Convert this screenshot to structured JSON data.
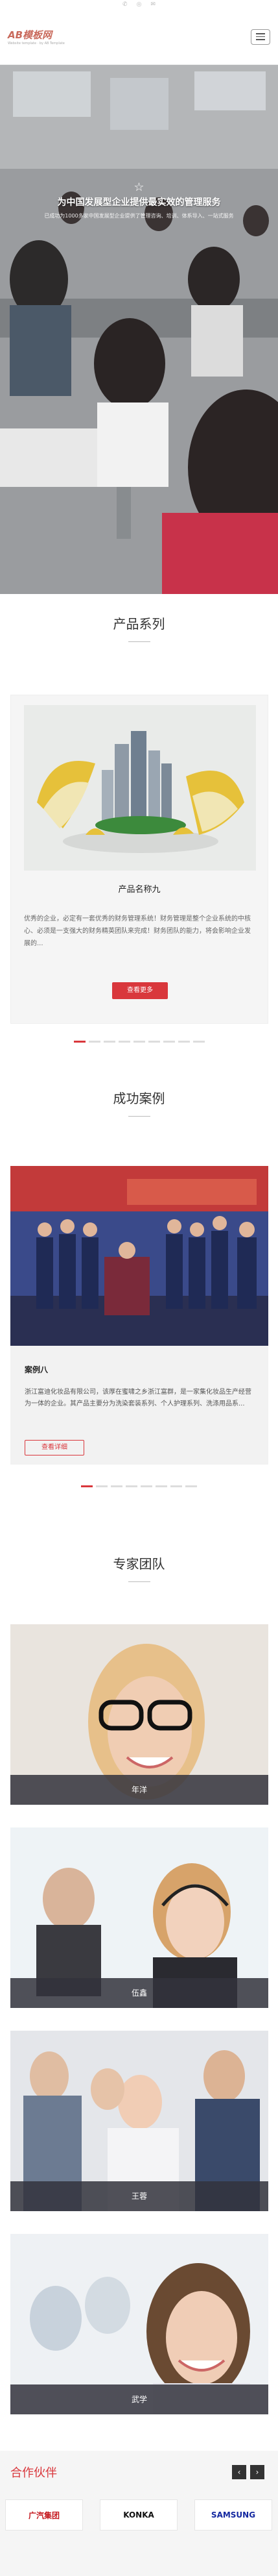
{
  "topbar": {
    "icons": [
      "phone-icon",
      "weibo-icon",
      "wechat-icon"
    ]
  },
  "header": {
    "logo_text": "AB模板网",
    "logo_sub": "Website template · by AB Template",
    "menu_icon": "hamburger-icon"
  },
  "hero": {
    "title": "为中国发展型企业提供最实效的管理服务",
    "subtitle": "已成功为1000多家中国发展型企业提供了管理咨询、培训、体系导入、一站式服务",
    "indicator_icon": "star-icon"
  },
  "products": {
    "section_title": "产品系列",
    "item": {
      "name": "产品名称九",
      "description": "优秀的企业，必定有一套优秀的财务管理系统！财务管理是整个企业系统的中核心、必须是一支强大的财务精英团队来完成！财务团队的能力，将会影响企业发展的...",
      "button": "查看更多"
    },
    "pager": {
      "count": 9,
      "active": 0
    }
  },
  "cases": {
    "section_title": "成功案例",
    "item": {
      "name": "案例八",
      "description": "浙江富迪化妆品有限公司，该厚在蜜啸之乡浙江富群，是一家集化妆品生产经营为一体的企业。其产品主要分为洗染套装系列、个人护理系列、洗涤用品系...",
      "button": "查看详细"
    },
    "pager": {
      "count": 8,
      "active": 0
    }
  },
  "team": {
    "section_title": "专家团队",
    "members": [
      {
        "name": "年洋"
      },
      {
        "name": "伍鑫"
      },
      {
        "name": "王蓉"
      },
      {
        "name": "武学"
      }
    ]
  },
  "partners": {
    "section_title": "合作伙伴",
    "prev_label": "‹",
    "next_label": "›",
    "logos": [
      {
        "name": "广汽集团"
      },
      {
        "name": "KONKA"
      },
      {
        "name": "SAMSUNG"
      }
    ],
    "logo_colors": [
      "#c4161c",
      "#111111",
      "#1428a0"
    ]
  },
  "colors": {
    "accent": "#d9373c",
    "dark_bar": "#32323c"
  }
}
